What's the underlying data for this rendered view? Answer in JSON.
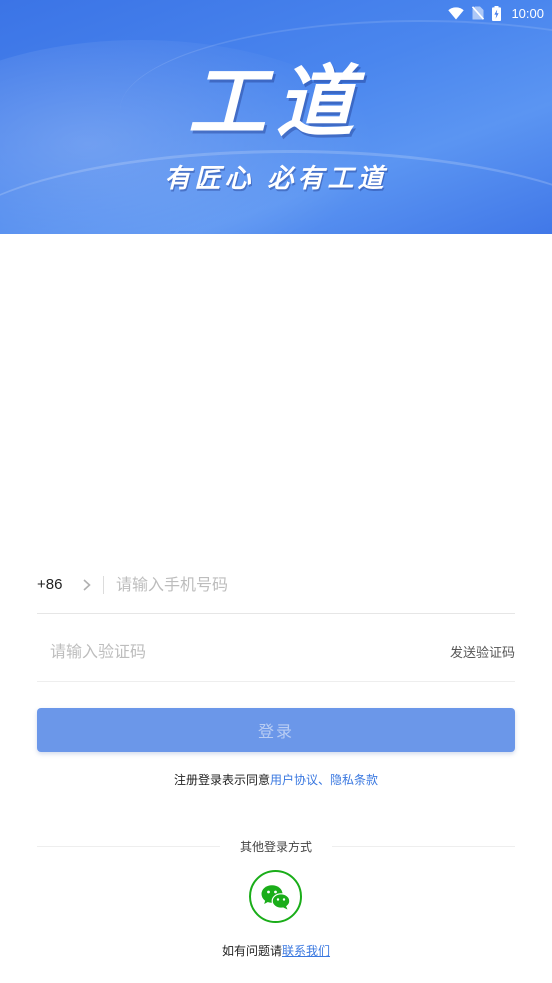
{
  "status_bar": {
    "time": "10:00",
    "icons": [
      "wifi-icon",
      "no-sim-icon",
      "battery-charging-icon"
    ]
  },
  "banner": {
    "title": "工道",
    "slogan": "有匠心  必有工道",
    "colors": {
      "primary": "#3b74e6",
      "light": "#5b95f2"
    }
  },
  "phone": {
    "country_code": "+86",
    "placeholder": "请输入手机号码",
    "value": ""
  },
  "verification": {
    "placeholder": "请输入验证码",
    "value": "",
    "send_label": "发送验证码"
  },
  "login_button": {
    "label": "登录",
    "color": "#6b97e9"
  },
  "agreement": {
    "prefix": "注册登录表示同意",
    "user_agreement": "用户协议",
    "separator": "、",
    "privacy_policy": "隐私条款",
    "link_color": "#3a78e0"
  },
  "other_login": {
    "title": "其他登录方式",
    "methods": [
      {
        "icon": "wechat-icon",
        "color": "#1aad19"
      }
    ]
  },
  "contact": {
    "prefix": "如有问题请",
    "link": "联系我们"
  }
}
